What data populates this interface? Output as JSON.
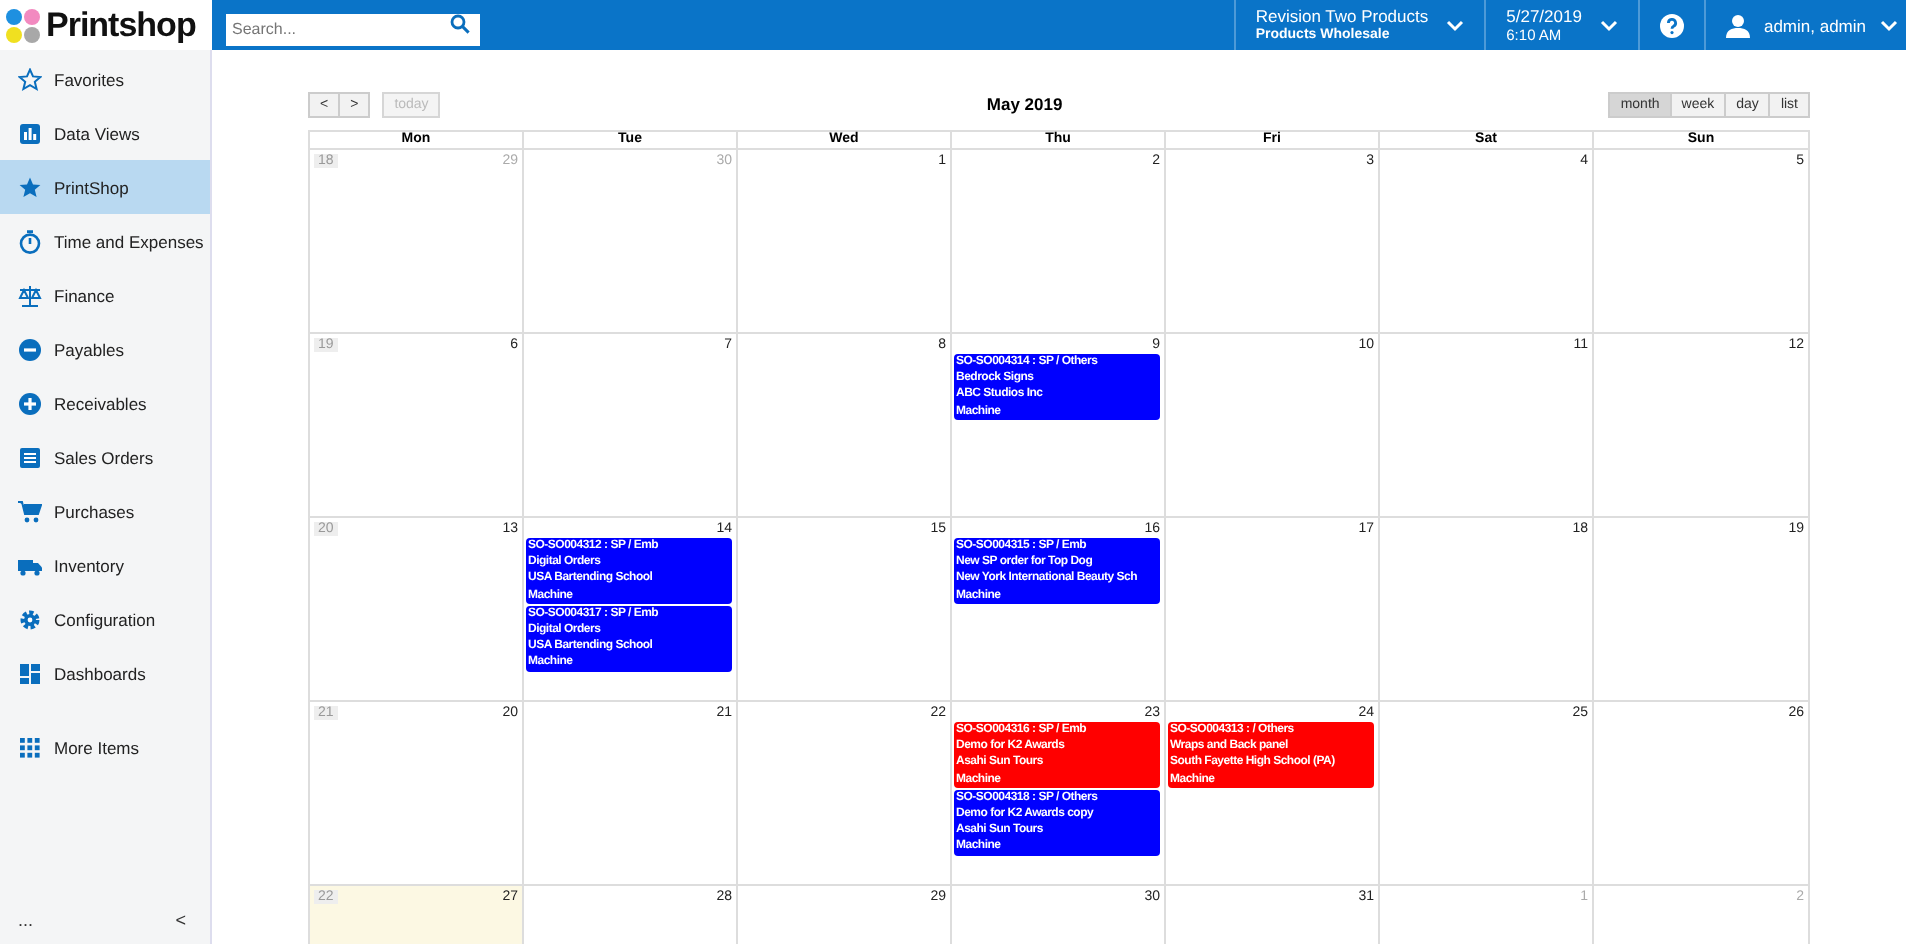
{
  "app": {
    "name": "Printshop"
  },
  "search": {
    "placeholder": "Search..."
  },
  "topbar": {
    "company": "Revision Two Products",
    "division": "Products Wholesale",
    "date": "5/27/2019",
    "time": "6:10 AM",
    "user": "admin, admin"
  },
  "sidebar": {
    "items": [
      {
        "label": "Favorites",
        "selected": false
      },
      {
        "label": "Data Views",
        "selected": false
      },
      {
        "label": "PrintShop",
        "selected": true
      },
      {
        "label": "Time and Expenses",
        "selected": false
      },
      {
        "label": "Finance",
        "selected": false
      },
      {
        "label": "Payables",
        "selected": false
      },
      {
        "label": "Receivables",
        "selected": false
      },
      {
        "label": "Sales Orders",
        "selected": false
      },
      {
        "label": "Purchases",
        "selected": false
      },
      {
        "label": "Inventory",
        "selected": false
      },
      {
        "label": "Configuration",
        "selected": false
      },
      {
        "label": "Dashboards",
        "selected": false
      },
      {
        "label": "More Items",
        "selected": false
      }
    ],
    "more": "...",
    "collapse": "<"
  },
  "calendar": {
    "title": "May 2019",
    "prev": "<",
    "next": ">",
    "today_button": {
      "label": "today",
      "disabled": true
    },
    "views": [
      {
        "label": "month",
        "selected": true
      },
      {
        "label": "week",
        "selected": false
      },
      {
        "label": "day",
        "selected": false
      },
      {
        "label": "list",
        "selected": false
      }
    ],
    "weekdays": [
      "Mon",
      "Tue",
      "Wed",
      "Thu",
      "Fri",
      "Sat",
      "Sun"
    ],
    "weeks": [
      {
        "week_number": "18",
        "days": [
          {
            "day": "29",
            "other_month": true,
            "today": false
          },
          {
            "day": "30",
            "other_month": true,
            "today": false
          },
          {
            "day": "1",
            "other_month": false,
            "today": false
          },
          {
            "day": "2",
            "other_month": false,
            "today": false
          },
          {
            "day": "3",
            "other_month": false,
            "today": false
          },
          {
            "day": "4",
            "other_month": false,
            "today": false
          },
          {
            "day": "5",
            "other_month": false,
            "today": false
          }
        ]
      },
      {
        "week_number": "19",
        "days": [
          {
            "day": "6",
            "other_month": false,
            "today": false
          },
          {
            "day": "7",
            "other_month": false,
            "today": false
          },
          {
            "day": "8",
            "other_month": false,
            "today": false
          },
          {
            "day": "9",
            "other_month": false,
            "today": false,
            "events": [
              {
                "color": "#0000ff",
                "lines": [
                  "SO-SO004314 : SP / Others",
                  "Bedrock Signs",
                  "ABC Studios Inc",
                  "Machine"
                ]
              }
            ]
          },
          {
            "day": "10",
            "other_month": false,
            "today": false
          },
          {
            "day": "11",
            "other_month": false,
            "today": false
          },
          {
            "day": "12",
            "other_month": false,
            "today": false
          }
        ]
      },
      {
        "week_number": "20",
        "days": [
          {
            "day": "13",
            "other_month": false,
            "today": false
          },
          {
            "day": "14",
            "other_month": false,
            "today": false,
            "events": [
              {
                "color": "#0000ff",
                "lines": [
                  "SO-SO004312 : SP / Emb",
                  "Digital Orders",
                  "USA Bartending School",
                  "Machine"
                ]
              },
              {
                "color": "#0000ff",
                "lines": [
                  "SO-SO004317 : SP / Emb",
                  "Digital Orders",
                  "USA Bartending School",
                  "Machine"
                ]
              }
            ]
          },
          {
            "day": "15",
            "other_month": false,
            "today": false
          },
          {
            "day": "16",
            "other_month": false,
            "today": false,
            "events": [
              {
                "color": "#0000ff",
                "lines": [
                  "SO-SO004315 : SP / Emb",
                  "New SP order for Top Dog",
                  "New York International Beauty Sch",
                  "Machine"
                ]
              }
            ]
          },
          {
            "day": "17",
            "other_month": false,
            "today": false
          },
          {
            "day": "18",
            "other_month": false,
            "today": false
          },
          {
            "day": "19",
            "other_month": false,
            "today": false
          }
        ]
      },
      {
        "week_number": "21",
        "days": [
          {
            "day": "20",
            "other_month": false,
            "today": false
          },
          {
            "day": "21",
            "other_month": false,
            "today": false
          },
          {
            "day": "22",
            "other_month": false,
            "today": false
          },
          {
            "day": "23",
            "other_month": false,
            "today": false,
            "events": [
              {
                "color": "#ff0000",
                "lines": [
                  "SO-SO004316 : SP / Emb",
                  "Demo for K2 Awards",
                  "Asahi Sun Tours",
                  "Machine"
                ]
              },
              {
                "color": "#0000ff",
                "lines": [
                  "SO-SO004318 : SP / Others",
                  "Demo for K2 Awards copy",
                  "Asahi Sun Tours",
                  "Machine"
                ]
              }
            ]
          },
          {
            "day": "24",
            "other_month": false,
            "today": false,
            "events": [
              {
                "color": "#ff0000",
                "lines": [
                  "SO-SO004313 : / Others",
                  "Wraps and Back panel",
                  "South Fayette High School (PA)",
                  "Machine"
                ]
              }
            ]
          },
          {
            "day": "25",
            "other_month": false,
            "today": false
          },
          {
            "day": "26",
            "other_month": false,
            "today": false
          }
        ]
      },
      {
        "week_number": "22",
        "days": [
          {
            "day": "27",
            "other_month": false,
            "today": true
          },
          {
            "day": "28",
            "other_month": false,
            "today": false
          },
          {
            "day": "29",
            "other_month": false,
            "today": false
          },
          {
            "day": "30",
            "other_month": false,
            "today": false
          },
          {
            "day": "31",
            "other_month": false,
            "today": false
          },
          {
            "day": "1",
            "other_month": true,
            "today": false
          },
          {
            "day": "2",
            "other_month": true,
            "today": false
          }
        ]
      }
    ]
  }
}
